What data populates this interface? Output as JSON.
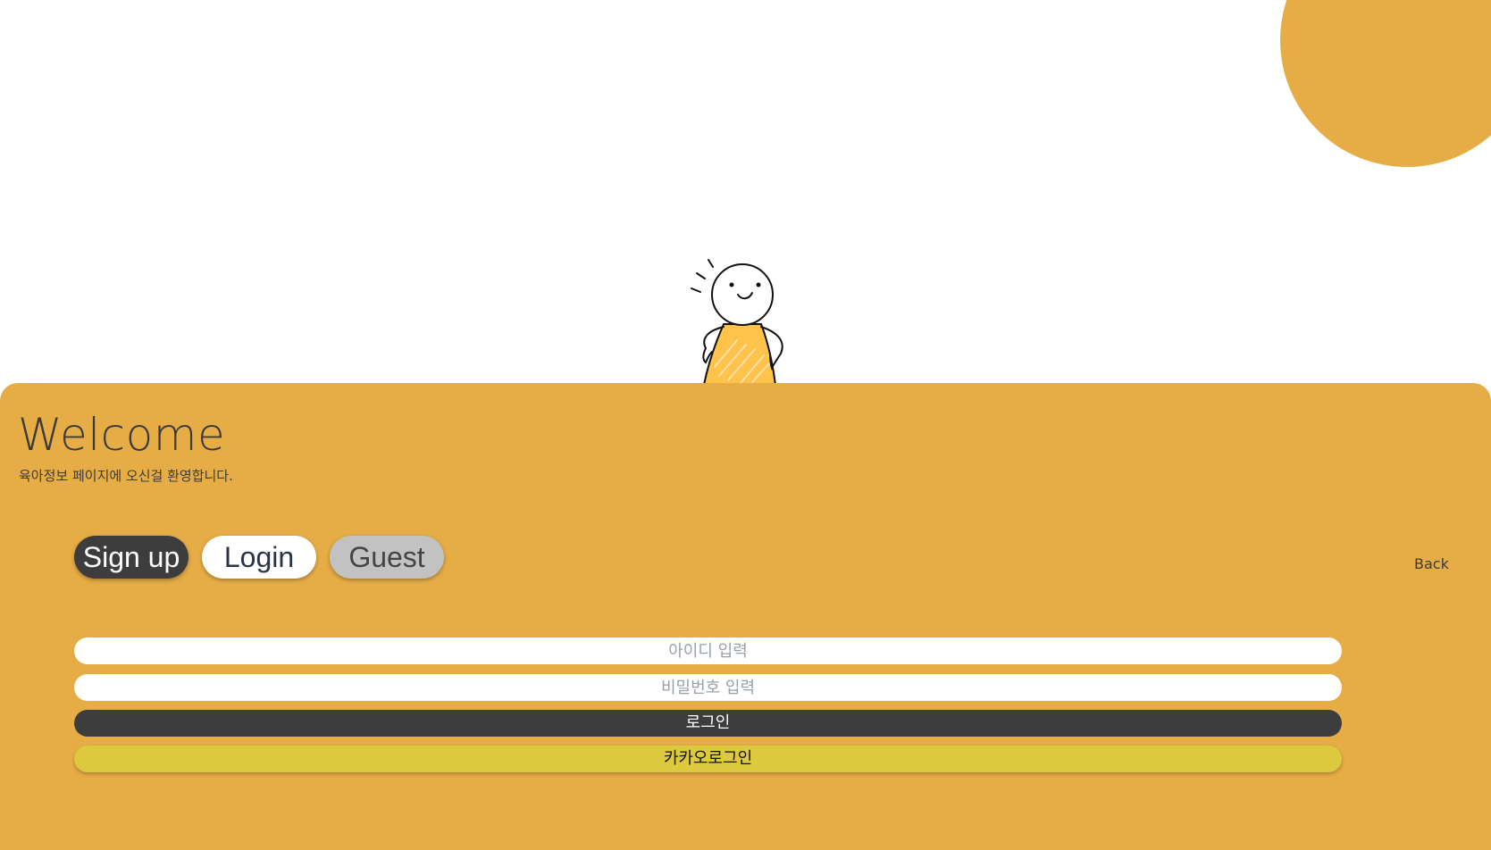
{
  "welcome": {
    "title": "Welcome",
    "subtitle": "육아정보 페이지에 오신걸 환영합니다."
  },
  "tabs": {
    "signup": "Sign up",
    "login": "Login",
    "guest": "Guest"
  },
  "back_label": "Back",
  "form": {
    "id_placeholder": "아이디 입력",
    "id_value": "",
    "password_placeholder": "비밀번호 입력",
    "password_value": "",
    "login_button": "로그인",
    "kakao_button": "카카오로그인"
  },
  "colors": {
    "panel": "#e6ad47",
    "dark_button": "#3d3d3d",
    "kakao_button": "#dcc93e",
    "mascot_shirt": "#ffc24a"
  },
  "icons": {
    "mascot": "waving-stick-figure"
  }
}
